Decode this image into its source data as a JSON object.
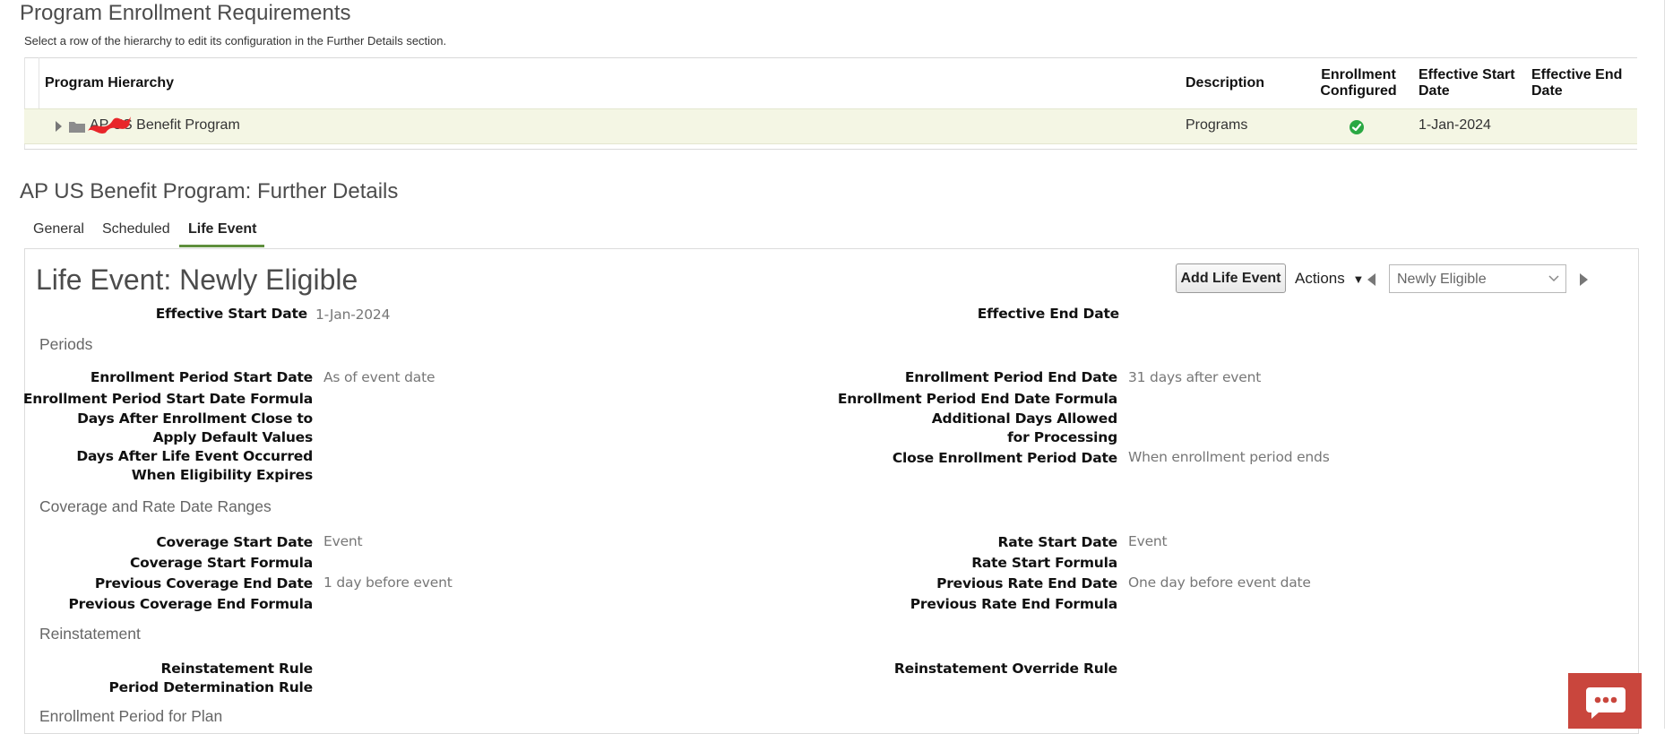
{
  "page": {
    "title": "Program Enrollment Requirements",
    "hint": "Select a row of the hierarchy to edit its configuration in the Further Details section."
  },
  "hierarchy_table": {
    "headers": {
      "program": "Program Hierarchy",
      "description": "Description",
      "enrollment": "Enrollment Configured",
      "start": "Effective Start Date",
      "end": "Effective End Date"
    },
    "rows": [
      {
        "program": "AP US Benefit Program",
        "description": "Programs",
        "enrollment_configured": true,
        "effective_start": "1-Jan-2024",
        "effective_end": ""
      }
    ]
  },
  "details": {
    "title": "AP US Benefit Program: Further Details",
    "tabs": [
      {
        "label": "General",
        "active": false
      },
      {
        "label": "Scheduled",
        "active": false
      },
      {
        "label": "Life Event",
        "active": true
      }
    ],
    "panel_title": "Life Event: Newly Eligible",
    "add_button": "Add Life Event",
    "actions_label": "Actions",
    "life_event_select": "Newly Eligible",
    "effective_start_label": "Effective Start Date",
    "effective_start_value": "1-Jan-2024",
    "effective_end_label": "Effective End Date",
    "sections": {
      "periods": "Periods",
      "coverage": "Coverage and Rate Date Ranges",
      "reinstatement": "Reinstatement",
      "enrollment_plan": "Enrollment Period for Plan"
    },
    "periods": {
      "enroll_start_label": "Enrollment Period Start Date",
      "enroll_start_value": "As of event date",
      "enroll_start_formula_label": "Enrollment Period Start Date Formula",
      "days_after_close_label": "Days After Enrollment Close to Apply Default Values",
      "days_after_event_label": "Days After Life Event Occurred When Eligibility Expires",
      "enroll_end_label": "Enrollment Period End Date",
      "enroll_end_value": "31 days after event",
      "enroll_end_formula_label": "Enrollment Period End Date Formula",
      "additional_days_label": "Additional Days Allowed for Processing",
      "close_period_label": "Close Enrollment Period Date",
      "close_period_value": "When enrollment period ends"
    },
    "coverage": {
      "cov_start_label": "Coverage Start Date",
      "cov_start_value": "Event",
      "cov_start_formula_label": "Coverage Start Formula",
      "prev_cov_end_label": "Previous Coverage End Date",
      "prev_cov_end_value": "1 day before event",
      "prev_cov_formula_label": "Previous Coverage End Formula",
      "rate_start_label": "Rate Start Date",
      "rate_start_value": "Event",
      "rate_start_formula_label": "Rate Start Formula",
      "prev_rate_end_label": "Previous Rate End Date",
      "prev_rate_end_value": "One day before event date",
      "prev_rate_formula_label": "Previous Rate End Formula"
    },
    "reinstatement": {
      "rule_label": "Reinstatement Rule",
      "period_rule_label": "Period Determination Rule",
      "override_label": "Reinstatement Override Rule"
    }
  },
  "icons": {
    "expand": "triangle-right-icon",
    "folder": "folder-icon",
    "check": "check-circle-icon",
    "chat": "chat-icon"
  },
  "colors": {
    "selected_row": "#f4f6e4",
    "check": "#2aa843",
    "tab_accent": "#5f8f3e",
    "chat": "#c9463d"
  }
}
